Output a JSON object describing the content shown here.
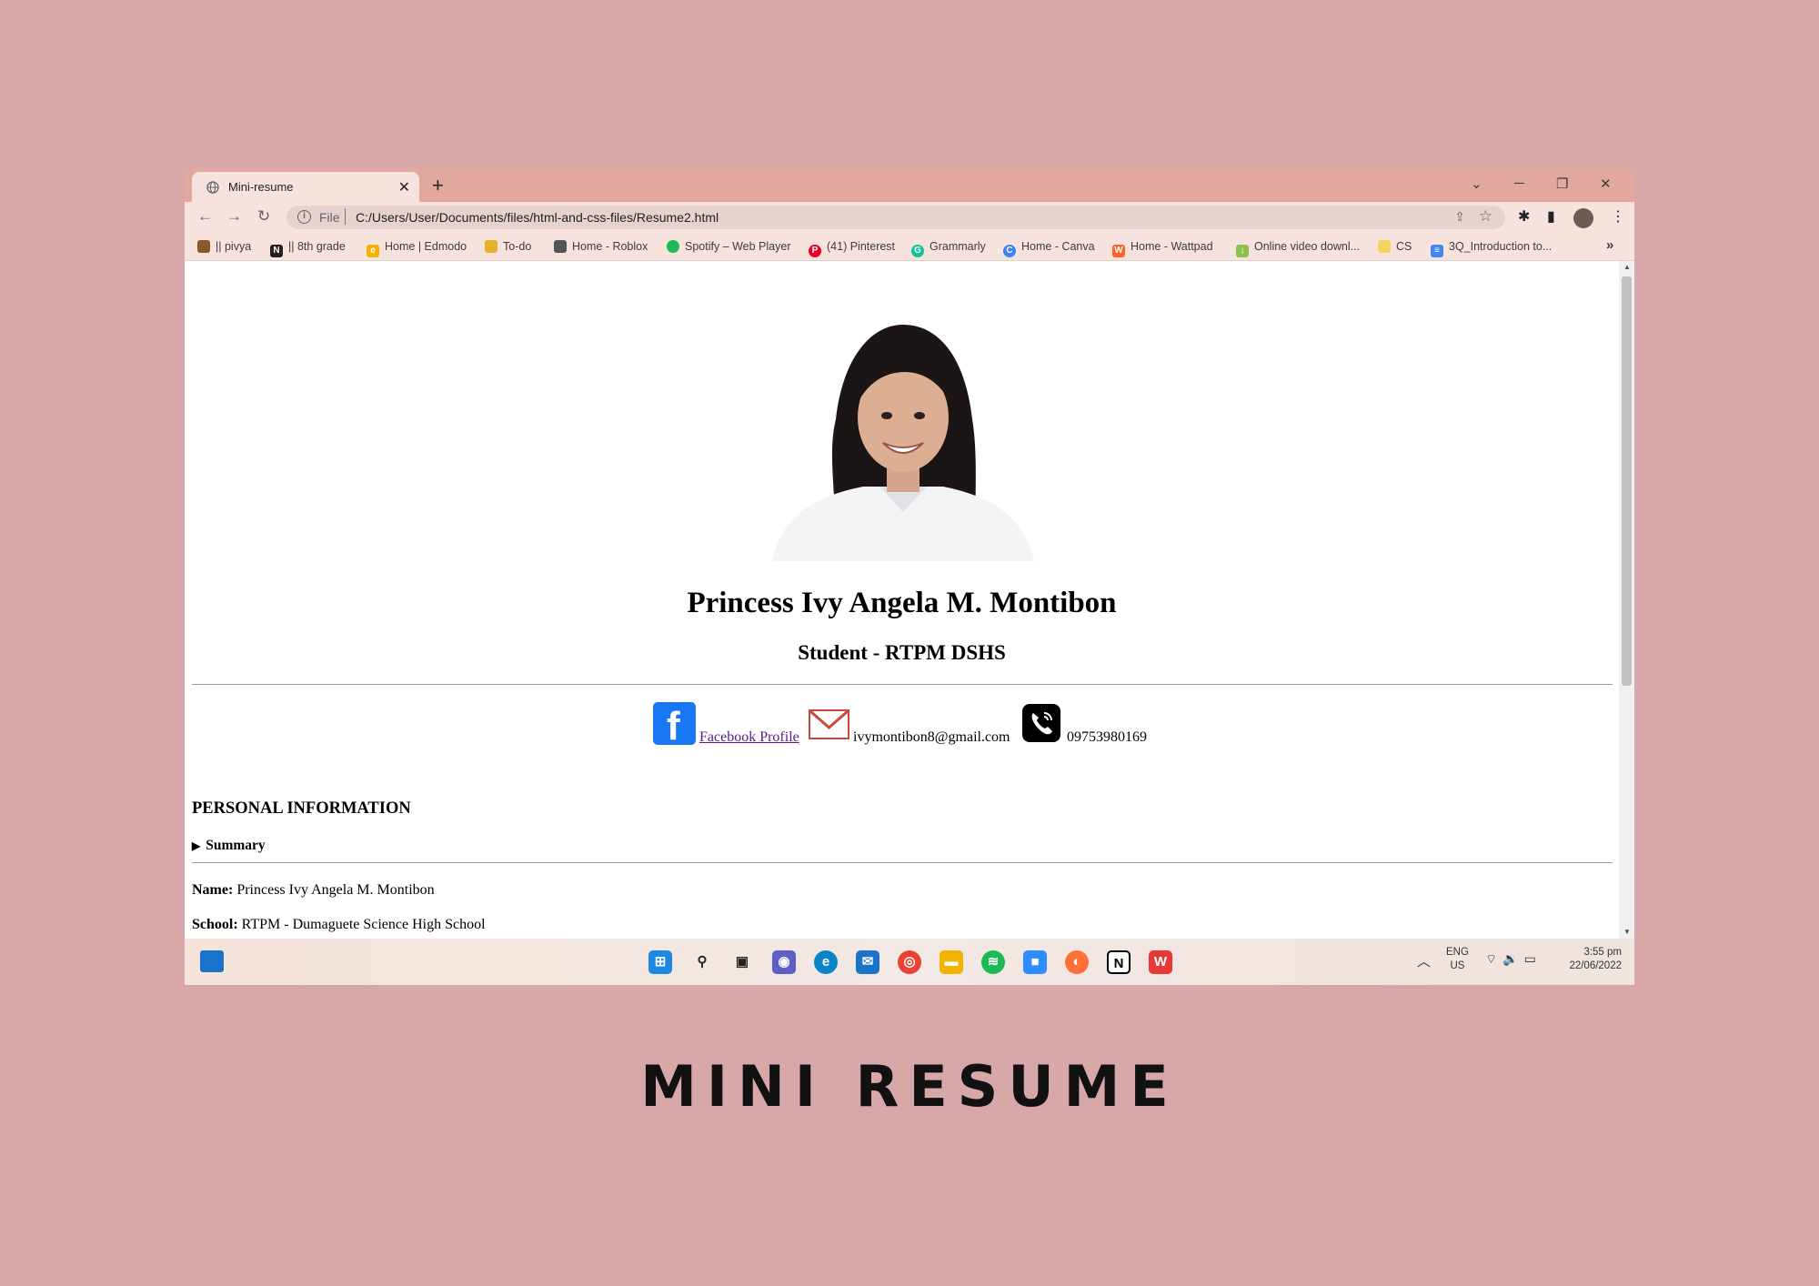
{
  "browser": {
    "tab_title": "Mini-resume",
    "address_scheme": "File",
    "address_url": "C:/Users/User/Documents/files/html-and-css-files/Resume2.html"
  },
  "bookmarks": [
    {
      "label": "|| pivya",
      "color": "#8a5a2b"
    },
    {
      "label": "|| 8th grade",
      "color": "#202020"
    },
    {
      "label": "Home | Edmodo",
      "color": "#f2b400"
    },
    {
      "label": "To-do",
      "color": "#e4b32a"
    },
    {
      "label": "Home - Roblox",
      "color": "#555555"
    },
    {
      "label": "Spotify – Web Player",
      "color": "#1db954"
    },
    {
      "label": "(41) Pinterest",
      "color": "#e60023"
    },
    {
      "label": "Grammarly",
      "color": "#15c39a"
    },
    {
      "label": "Home - Canva",
      "color": "#3b82f6"
    },
    {
      "label": "Home - Wattpad",
      "color": "#ff6122"
    },
    {
      "label": "Online video downl...",
      "color": "#8bc34a"
    },
    {
      "label": "CS",
      "color": "#f4d35e"
    },
    {
      "label": "3Q_Introduction to...",
      "color": "#4285f4"
    }
  ],
  "resume": {
    "name": "Princess Ivy Angela M. Montibon",
    "role": "Student - RTPM DSHS",
    "facebook_label": "Facebook Profile ",
    "email": "ivymontibon8@gmail.com",
    "phone": "09753980169",
    "section_title": "PERSONAL INFORMATION",
    "summary_label": "Summary",
    "fields": [
      {
        "label": "Name:",
        "value": "Princess Ivy Angela M. Montibon"
      },
      {
        "label": "School:",
        "value": "RTPM - Dumaguete Science High School"
      }
    ]
  },
  "taskbar": {
    "lang_top": "ENG",
    "lang_bottom": "US",
    "time": "3:55 pm",
    "date": "22/06/2022"
  },
  "caption": "MINI RESUME"
}
